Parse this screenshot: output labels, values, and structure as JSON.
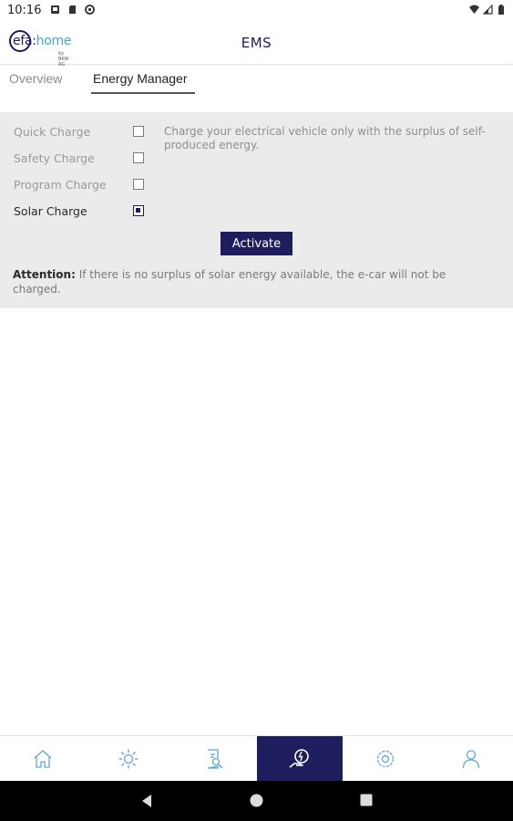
{
  "status_bar": {
    "time": "10:16"
  },
  "app_bar": {
    "logo_main": "efa:",
    "logo_home": "home",
    "logo_sub": "by BKW AG",
    "title": "EMS"
  },
  "tabs": [
    {
      "label": "Overview",
      "selected": false
    },
    {
      "label": "Energy Manager",
      "selected": true
    }
  ],
  "options": [
    {
      "label": "Quick Charge",
      "checked": false
    },
    {
      "label": "Safety Charge",
      "checked": false
    },
    {
      "label": "Program Charge",
      "checked": false
    },
    {
      "label": "Solar Charge",
      "checked": true
    }
  ],
  "description": "Charge your electrical vehicle only with the surplus of self-produced energy.",
  "activate_label": "Activate",
  "attention": {
    "label": "Attention:",
    "text": " If there is no surplus of solar energy available, the e-car will not be charged."
  },
  "bottom_nav": [
    {
      "icon": "home-icon",
      "active": false
    },
    {
      "icon": "sun-icon",
      "active": false
    },
    {
      "icon": "report-search-icon",
      "active": false
    },
    {
      "icon": "energy-manager-icon",
      "active": true
    },
    {
      "icon": "settings-icon",
      "active": false
    },
    {
      "icon": "user-icon",
      "active": false
    }
  ],
  "colors": {
    "brand": "#1e1e5e",
    "accent": "#3fa7d6",
    "panel": "#ebebeb"
  }
}
